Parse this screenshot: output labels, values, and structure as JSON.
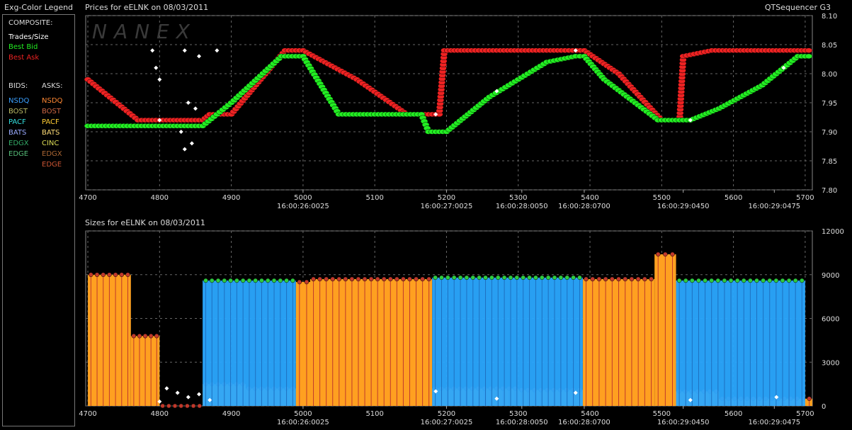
{
  "legend": {
    "title": "Exg-Color Legend",
    "composite_heading": "COMPOSITE:",
    "composite": [
      {
        "label": "Trades/Size",
        "color": "#ffffff"
      },
      {
        "label": "Best Bid",
        "color": "#22ee22"
      },
      {
        "label": "Best Ask",
        "color": "#ee2222"
      }
    ],
    "bids_heading": "BIDS:",
    "asks_heading": "ASKS:",
    "bids": [
      {
        "label": "NSDQ",
        "color": "#3aa0ff"
      },
      {
        "label": "BOST",
        "color": "#bbbb66"
      },
      {
        "label": "PACF",
        "color": "#33dddd"
      },
      {
        "label": "BATS",
        "color": "#99aaff"
      },
      {
        "label": "EDGX",
        "color": "#33aa66"
      },
      {
        "label": "EDGE",
        "color": "#55bb77"
      }
    ],
    "asks": [
      {
        "label": "NSDQ",
        "color": "#ff8833"
      },
      {
        "label": "BOST",
        "color": "#cc6644"
      },
      {
        "label": "PACF",
        "color": "#ffcc33"
      },
      {
        "label": "BATS",
        "color": "#ffdd77"
      },
      {
        "label": "CINC",
        "color": "#dddd55"
      },
      {
        "label": "EDGX",
        "color": "#aa6633"
      },
      {
        "label": "EDGE",
        "color": "#cc5533"
      }
    ]
  },
  "chart_data": [
    {
      "type": "scatter",
      "title": "Prices for  eELNK  on  08/03/2011",
      "subtitle": "QTSequencer G3",
      "watermark": "NANEX",
      "x_ticks": [
        4700,
        4800,
        4900,
        5000,
        5100,
        5200,
        5300,
        5400,
        5500,
        5600,
        5700
      ],
      "xlim": [
        4697,
        5710
      ],
      "time_labels": [
        {
          "x": 5000,
          "label": "16:00:26:0025"
        },
        {
          "x": 5200,
          "label": "16:00:27:0025"
        },
        {
          "x": 5305,
          "label": "16:00:28:0050"
        },
        {
          "x": 5392,
          "label": "16:00:28:0700"
        },
        {
          "x": 5530,
          "label": "16:00:29:0450"
        },
        {
          "x": 5657,
          "label": "16:00:29:0475"
        }
      ],
      "y_ticks": [
        "8.10",
        "8.05",
        "8.00",
        "7.95",
        "7.90",
        "7.85",
        "7.80"
      ],
      "ylim": [
        7.8,
        8.1
      ],
      "grid": true,
      "series": [
        {
          "name": "Best Ask",
          "color": "#ee2222",
          "points": [
            [
              4700,
              7.99
            ],
            [
              4770,
              7.92
            ],
            [
              4860,
              7.92
            ],
            [
              4870,
              7.93
            ],
            [
              4890,
              7.93
            ],
            [
              4900,
              7.93
            ],
            [
              4975,
              8.04
            ],
            [
              5000,
              8.04
            ],
            [
              5075,
              7.99
            ],
            [
              5145,
              7.93
            ],
            [
              5190,
              7.93
            ],
            [
              5197,
              8.04
            ],
            [
              5230,
              8.04
            ],
            [
              5290,
              8.04
            ],
            [
              5305,
              8.04
            ],
            [
              5360,
              8.04
            ],
            [
              5392,
              8.04
            ],
            [
              5440,
              8.0
            ],
            [
              5500,
              7.92
            ],
            [
              5525,
              7.92
            ],
            [
              5530,
              8.03
            ],
            [
              5570,
              8.04
            ],
            [
              5600,
              8.04
            ],
            [
              5710,
              8.04
            ]
          ]
        },
        {
          "name": "Best Bid",
          "color": "#22ee22",
          "points": [
            [
              4700,
              7.91
            ],
            [
              4770,
              7.91
            ],
            [
              4860,
              7.91
            ],
            [
              4900,
              7.95
            ],
            [
              4970,
              8.03
            ],
            [
              5000,
              8.03
            ],
            [
              5050,
              7.93
            ],
            [
              5100,
              7.93
            ],
            [
              5165,
              7.93
            ],
            [
              5175,
              7.9
            ],
            [
              5200,
              7.9
            ],
            [
              5260,
              7.96
            ],
            [
              5300,
              7.99
            ],
            [
              5340,
              8.02
            ],
            [
              5380,
              8.03
            ],
            [
              5392,
              8.03
            ],
            [
              5420,
              7.99
            ],
            [
              5495,
              7.92
            ],
            [
              5540,
              7.92
            ],
            [
              5580,
              7.94
            ],
            [
              5640,
              7.98
            ],
            [
              5690,
              8.03
            ],
            [
              5710,
              8.03
            ]
          ]
        },
        {
          "name": "Trades/Size",
          "color": "#ffffff",
          "points": [
            [
              4790,
              8.04
            ],
            [
              4795,
              8.01
            ],
            [
              4800,
              7.99
            ],
            [
              4835,
              8.04
            ],
            [
              4855,
              8.03
            ],
            [
              4880,
              8.04
            ],
            [
              4840,
              7.95
            ],
            [
              4850,
              7.94
            ],
            [
              4800,
              7.92
            ],
            [
              4830,
              7.9
            ],
            [
              4835,
              7.87
            ],
            [
              4845,
              7.88
            ],
            [
              5185,
              7.93
            ],
            [
              5270,
              7.97
            ],
            [
              5380,
              8.04
            ],
            [
              5540,
              7.92
            ],
            [
              5670,
              8.01
            ]
          ]
        }
      ]
    },
    {
      "type": "bar",
      "title": "Sizes for  eELNK  on  08/03/2011",
      "x_ticks": [
        4700,
        4800,
        4900,
        5000,
        5100,
        5200,
        5300,
        5400,
        5500,
        5600,
        5700
      ],
      "xlim": [
        4697,
        5710
      ],
      "time_labels": [
        {
          "x": 5000,
          "label": "16:00:26:0025"
        },
        {
          "x": 5200,
          "label": "16:00:27:0025"
        },
        {
          "x": 5305,
          "label": "16:00:28:0050"
        },
        {
          "x": 5392,
          "label": "16:00:28:0700"
        },
        {
          "x": 5530,
          "label": "16:00:29:0450"
        },
        {
          "x": 5657,
          "label": "16:00:29:0475"
        }
      ],
      "y_ticks": [
        "12000",
        "9000",
        "6000",
        "3000",
        "0"
      ],
      "ylim": [
        0,
        12000
      ],
      "grid": true,
      "series": [
        {
          "name": "Best Ask",
          "color": "#ffa020",
          "segments": [
            [
              4700,
              4760,
              9000
            ],
            [
              4760,
              4800,
              4800
            ],
            [
              4800,
              4860,
              0
            ],
            [
              4860,
              4920,
              1500
            ],
            [
              4920,
              4990,
              1200
            ],
            [
              4990,
              5010,
              8500
            ],
            [
              5010,
              5180,
              8700
            ],
            [
              5180,
              5300,
              1200
            ],
            [
              5300,
              5390,
              1100
            ],
            [
              5390,
              5490,
              8700
            ],
            [
              5490,
              5520,
              10400
            ],
            [
              5520,
              5580,
              1000
            ],
            [
              5580,
              5710,
              500
            ]
          ]
        },
        {
          "name": "Best Bid",
          "color": "#2aa8ff",
          "segments": [
            [
              4860,
              4990,
              8600
            ],
            [
              5180,
              5390,
              8800
            ],
            [
              5520,
              5700,
              8600
            ]
          ]
        },
        {
          "name": "Trades/Size",
          "color": "#ffffff",
          "points": [
            [
              4800,
              300
            ],
            [
              4810,
              1200
            ],
            [
              4825,
              900
            ],
            [
              4840,
              600
            ],
            [
              4855,
              800
            ],
            [
              4870,
              400
            ],
            [
              5185,
              1000
            ],
            [
              5270,
              500
            ],
            [
              5380,
              900
            ],
            [
              5540,
              400
            ],
            [
              5660,
              600
            ]
          ]
        }
      ]
    }
  ]
}
